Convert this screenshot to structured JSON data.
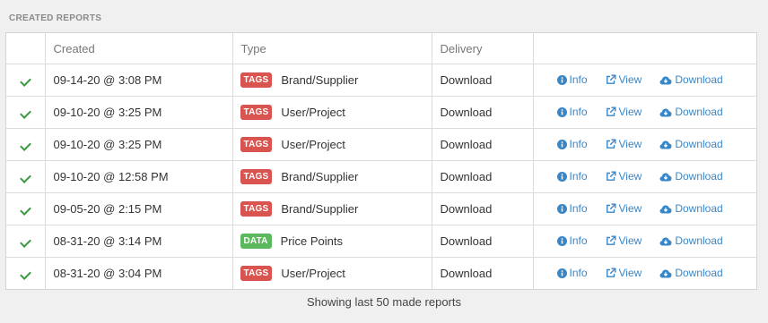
{
  "section_title": "CREATED REPORTS",
  "columns": [
    "",
    "Created",
    "Type",
    "Delivery",
    ""
  ],
  "rows": [
    {
      "status": "success",
      "created": "09-14-20 @ 3:08 PM",
      "badge": "TAGS",
      "badge_kind": "tags",
      "type": "Brand/Supplier",
      "delivery": "Download"
    },
    {
      "status": "success",
      "created": "09-10-20 @ 3:25 PM",
      "badge": "TAGS",
      "badge_kind": "tags",
      "type": "User/Project",
      "delivery": "Download"
    },
    {
      "status": "success",
      "created": "09-10-20 @ 3:25 PM",
      "badge": "TAGS",
      "badge_kind": "tags",
      "type": "User/Project",
      "delivery": "Download"
    },
    {
      "status": "success",
      "created": "09-10-20 @ 12:58 PM",
      "badge": "TAGS",
      "badge_kind": "tags",
      "type": "Brand/Supplier",
      "delivery": "Download"
    },
    {
      "status": "success",
      "created": "09-05-20 @ 2:15 PM",
      "badge": "TAGS",
      "badge_kind": "tags",
      "type": "Brand/Supplier",
      "delivery": "Download"
    },
    {
      "status": "success",
      "created": "08-31-20 @ 3:14 PM",
      "badge": "DATA",
      "badge_kind": "data",
      "type": "Price Points",
      "delivery": "Download"
    },
    {
      "status": "success",
      "created": "08-31-20 @ 3:04 PM",
      "badge": "TAGS",
      "badge_kind": "tags",
      "type": "User/Project",
      "delivery": "Download"
    }
  ],
  "actions": {
    "info": "Info",
    "view": "View",
    "download": "Download"
  },
  "icons": {
    "status": "check-icon",
    "info": "info-circle-icon",
    "view": "external-link-icon",
    "download": "cloud-download-icon"
  },
  "colors": {
    "tags": "#d9534f",
    "data": "#5cb85c",
    "link": "#3a87c8",
    "check": "#3a9a3f"
  },
  "footer": "Showing last 50 made reports"
}
